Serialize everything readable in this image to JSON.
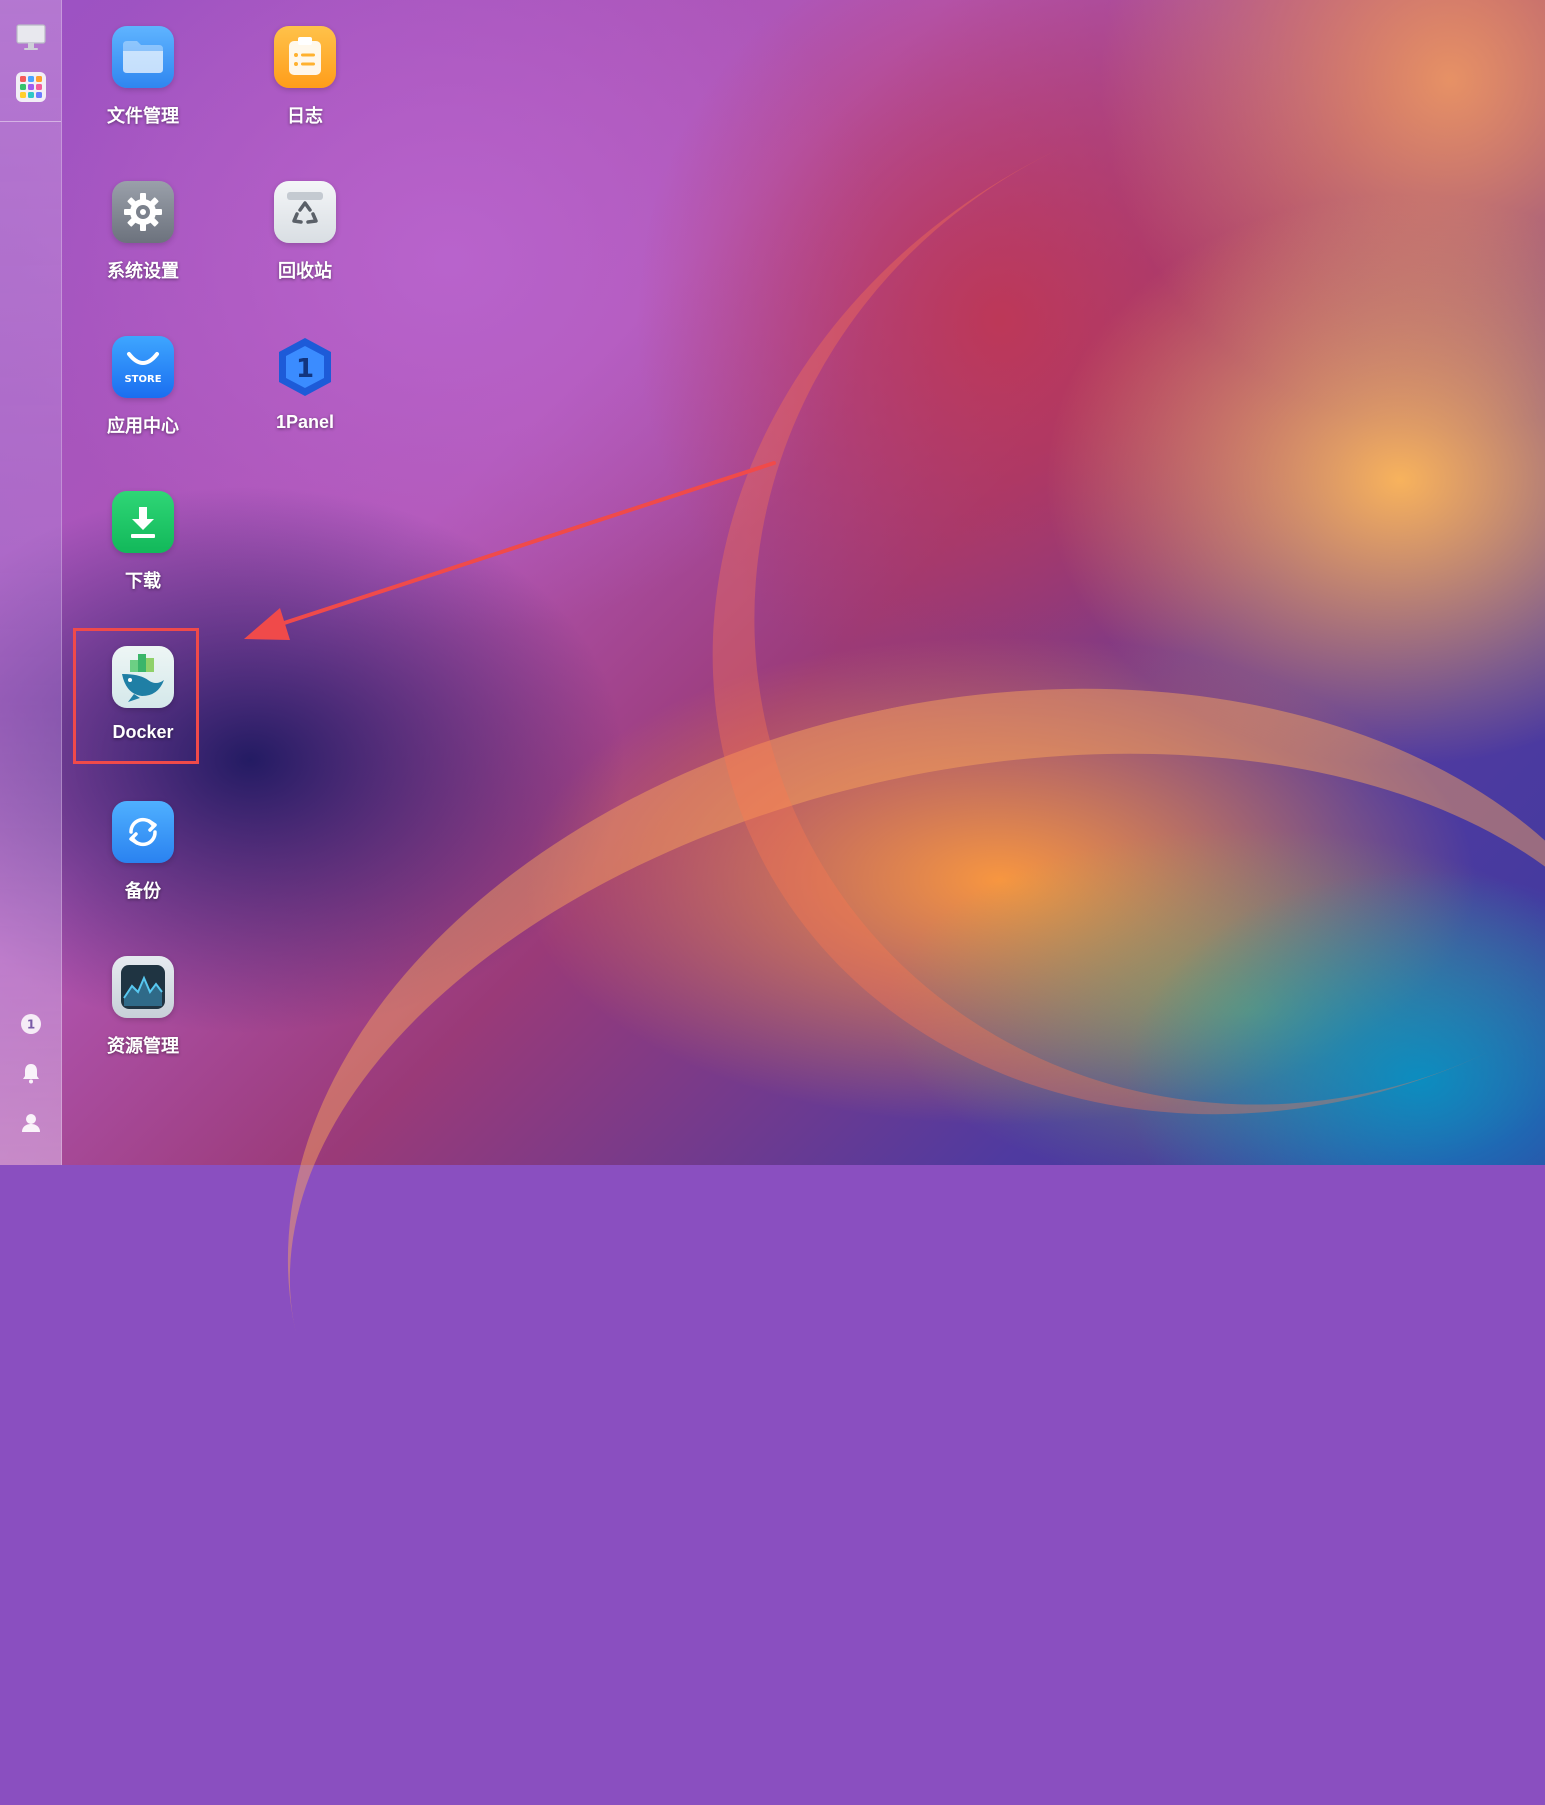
{
  "desktop": {
    "apps": [
      {
        "id": "file-manager",
        "label": "文件管理",
        "icon": "folder-icon"
      },
      {
        "id": "logs",
        "label": "日志",
        "icon": "clipboard-icon"
      },
      {
        "id": "system-settings",
        "label": "系统设置",
        "icon": "gear-icon"
      },
      {
        "id": "recycle-bin",
        "label": "回收站",
        "icon": "recycle-icon"
      },
      {
        "id": "app-center",
        "label": "应用中心",
        "icon": "store-icon",
        "badge": "STORE"
      },
      {
        "id": "1panel",
        "label": "1Panel",
        "icon": "1panel-icon",
        "glyph": "1"
      },
      {
        "id": "download",
        "label": "下载",
        "icon": "download-icon"
      },
      {
        "id": "docker",
        "label": "Docker",
        "icon": "docker-icon"
      },
      {
        "id": "backup",
        "label": "备份",
        "icon": "sync-icon"
      },
      {
        "id": "resource-manager",
        "label": "资源管理",
        "icon": "activity-monitor-icon"
      }
    ]
  },
  "sidebar": {
    "top": [
      {
        "icon": "monitor-icon"
      },
      {
        "icon": "app-grid-icon"
      }
    ],
    "bottom": [
      {
        "icon": "1panel-small-icon"
      },
      {
        "icon": "bell-icon"
      },
      {
        "icon": "user-icon"
      }
    ]
  },
  "colors": {
    "highlight_box": "#f04a4a",
    "arrow": "#f04a4a"
  }
}
